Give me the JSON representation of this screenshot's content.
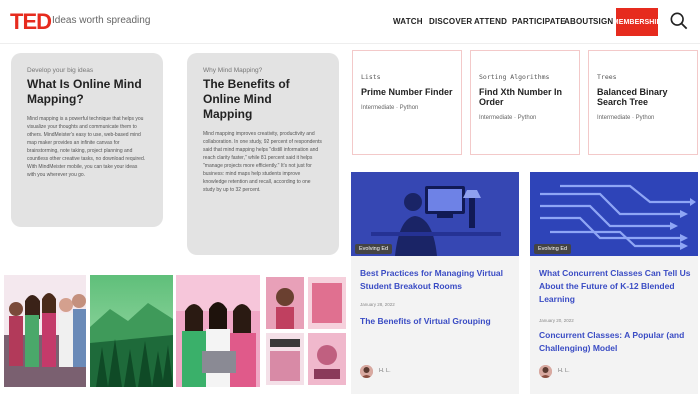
{
  "header": {
    "logo": "TED",
    "tagline": "Ideas worth spreading",
    "nav": [
      "WATCH",
      "DISCOVER",
      "ATTEND",
      "PARTICIPATE",
      "ABOUT",
      "SIGN IN"
    ],
    "membership": "MEMBERSHIP",
    "search_icon": "search-icon"
  },
  "mind_map_cards": [
    {
      "kicker": "Develop your big ideas",
      "title": "What Is Online Mind Mapping?",
      "text": "Mind mapping is a powerful technique that helps you visualize your thoughts and communicate them to others. MindMeister's easy to use, web-based mind map maker provides an infinite canvas for brainstorming, note taking, project planning and countless other creative tasks, no download required. With MindMeister mobile, you can take your ideas with you wherever you go."
    },
    {
      "kicker": "Why Mind Mapping?",
      "title": "The Benefits of Online Mind Mapping",
      "text": "Mind mapping improves creativity, productivity and collaboration. In one study, 92 percent of respondents said that mind mapping helps \"distill information and reach clarity faster,\" while 81 percent said it helps \"manage projects more efficiently.\" It's not just for business: mind maps help students improve knowledge retention and recall, according to one study by up to 32 percent."
    }
  ],
  "code_cards": [
    {
      "tag": "Lists",
      "title": "Prime Number Finder",
      "meta": "Intermediate · Python"
    },
    {
      "tag": "Sorting Algorithms",
      "title": "Find Xth Number In Order",
      "meta": "Intermediate · Python"
    },
    {
      "tag": "Trees",
      "title": "Balanced Binary Search Tree",
      "meta": "Intermediate · Python"
    }
  ],
  "blog_cards": [
    {
      "tag": "Evolving Ed",
      "title": "Best Practices for Managing Virtual Student Breakout Rooms",
      "date": "January 28, 2022",
      "subtitle": "The Benefits of Virtual Grouping",
      "author": "H. L."
    },
    {
      "tag": "Evolving Ed",
      "title": "What Concurrent Classes Can Tell Us About the Future of K-12 Blended Learning",
      "date": "January 20, 2022",
      "subtitle": "Concurrent Classes: A Popular (and Challenging) Model",
      "author": "H. L."
    }
  ],
  "colors": {
    "ted_red": "#e62b1e",
    "link_blue": "#3a4cc4",
    "card_gray": "#e3e3e3"
  }
}
